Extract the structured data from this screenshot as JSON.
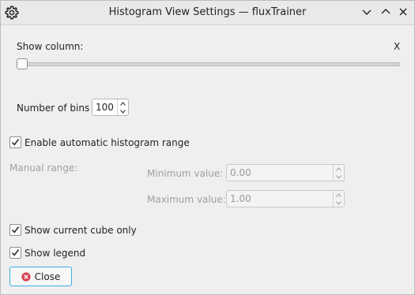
{
  "window": {
    "title": "Histogram View Settings — fluxTrainer",
    "icon": "gear-icon",
    "controls": [
      "chevron-down-icon",
      "chevron-up-icon",
      "close-icon"
    ]
  },
  "column": {
    "label": "Show column:",
    "current": "X",
    "slider_position": 0
  },
  "bins": {
    "label": "Number of bins",
    "value": "100"
  },
  "auto_range": {
    "label": "Enable automatic histogram range",
    "checked": true
  },
  "manual_range": {
    "label": "Manual range:",
    "enabled": false,
    "min_label": "Minimum value:",
    "min_value": "0.00",
    "max_label": "Maximum value:",
    "max_value": "1.00"
  },
  "options": {
    "current_cube_label": "Show current cube only",
    "current_cube_checked": true,
    "legend_label": "Show legend",
    "legend_checked": true
  },
  "close_button": {
    "label": "Close",
    "icon": "close-circle-icon",
    "icon_color": "#da4453"
  },
  "colors": {
    "accent": "#3daee9",
    "background": "#efefef"
  }
}
